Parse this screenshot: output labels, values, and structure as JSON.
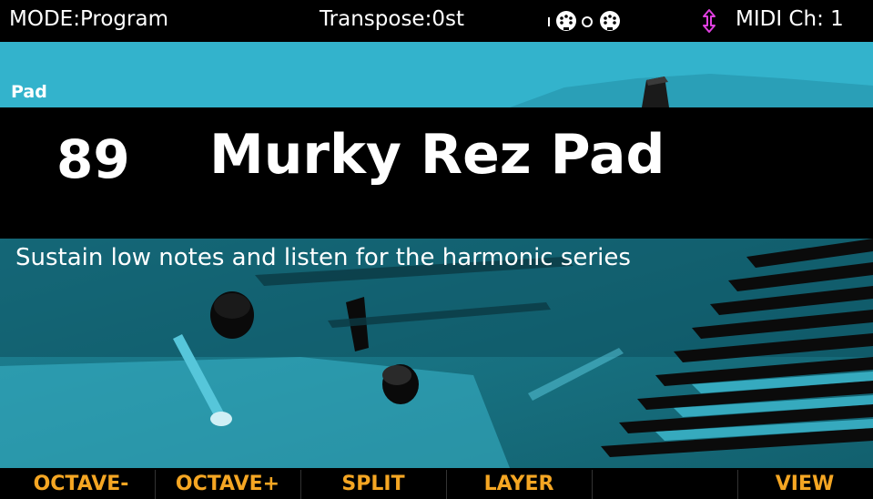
{
  "status": {
    "mode": "MODE:Program",
    "transpose": "Transpose:0st",
    "midi_channel": "MIDI Ch: 1",
    "icons": [
      "midi-port-1-icon",
      "midi-port-0-icon",
      "updown-arrow-icon"
    ]
  },
  "category_tab": "Pad",
  "program": {
    "number": "89",
    "name": "Murky Rez Pad",
    "hint": "Sustain low notes and listen for the harmonic series"
  },
  "soft_buttons": [
    "OCTAVE-",
    "OCTAVE+",
    "SPLIT",
    "LAYER",
    "",
    "VIEW"
  ],
  "colors": {
    "accent": "#33b3cc",
    "soft_button_text": "#f5a623",
    "updown_arrow": "#e040e0",
    "background": "#000000",
    "text": "#ffffff"
  }
}
